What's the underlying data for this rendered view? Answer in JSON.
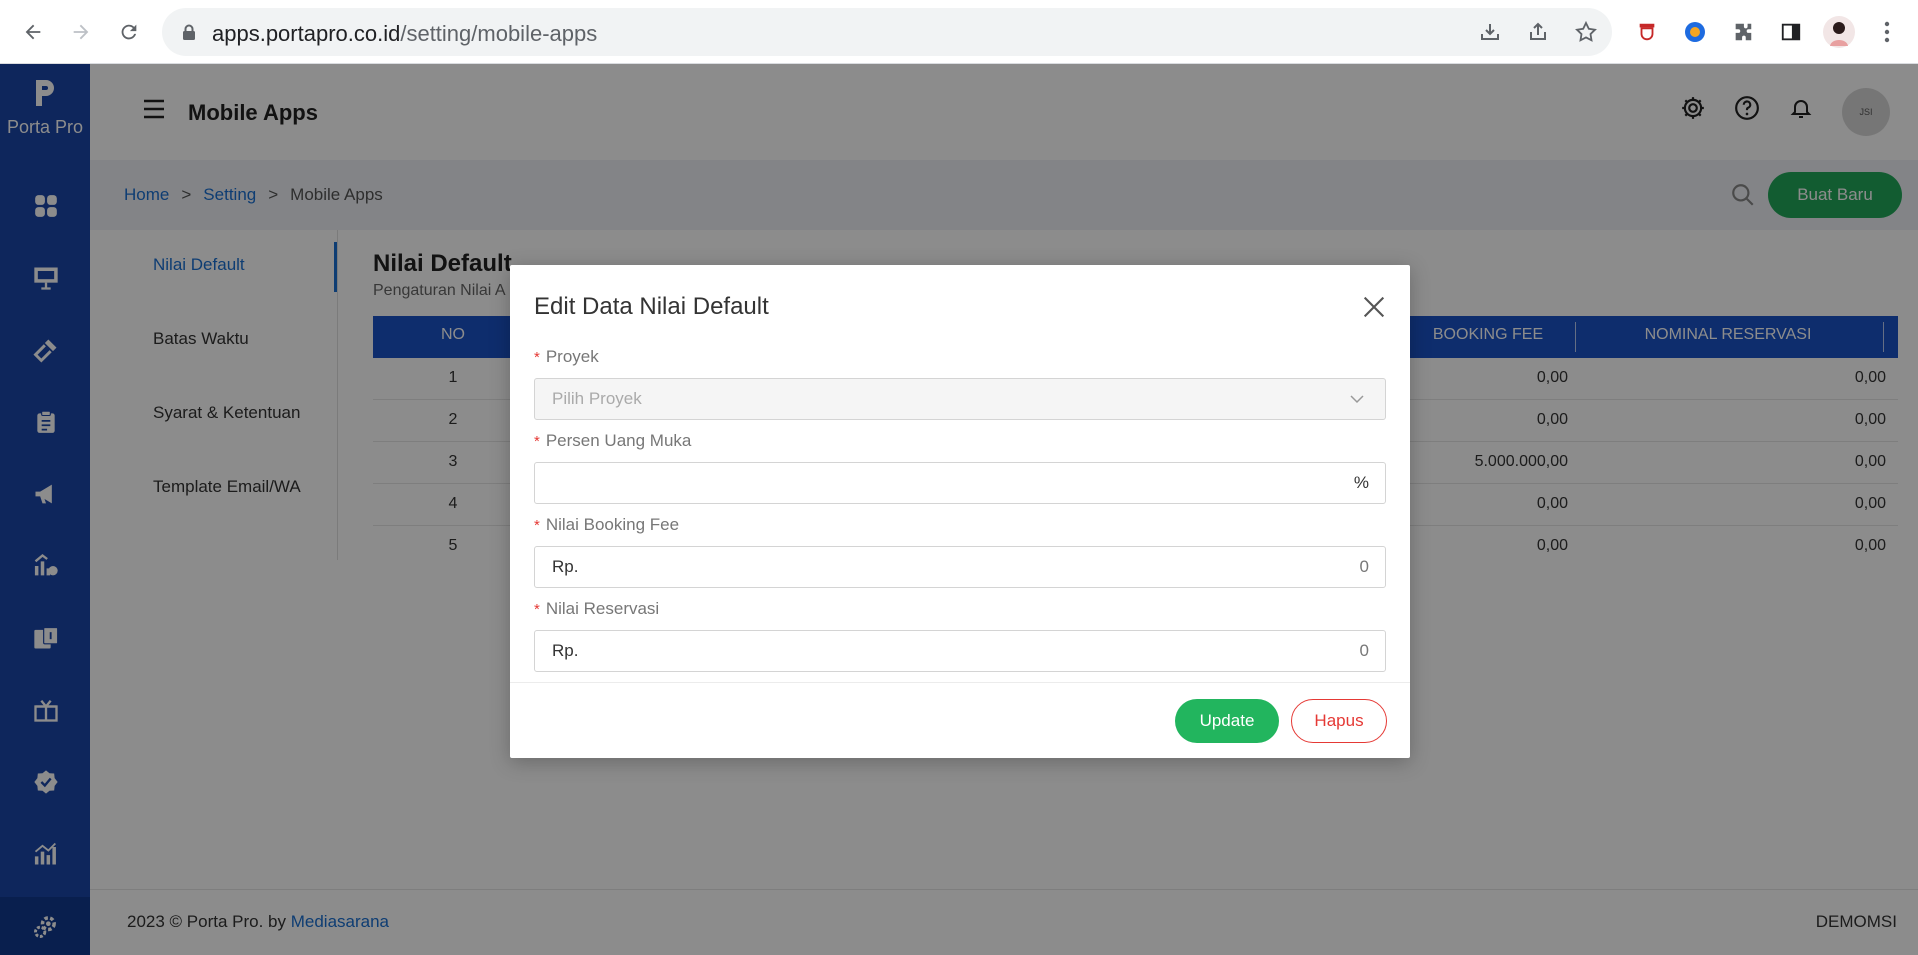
{
  "browser": {
    "url_host": "apps.portapro.co.id",
    "url_path": "/setting/mobile-apps"
  },
  "app": {
    "logo_text": "Porta Pro",
    "page_title": "Mobile Apps",
    "breadcrumb": [
      "Home",
      "Setting",
      "Mobile Apps"
    ],
    "create_button": "Buat Baru",
    "avatar_text": "JSI"
  },
  "tabs": [
    "Nilai Default",
    "Batas Waktu",
    "Syarat & Ketentuan",
    "Template Email/WA"
  ],
  "section": {
    "title": "Nilai Default",
    "subtitle": "Pengaturan Nilai A"
  },
  "table": {
    "headers": [
      "NO",
      "BOOKING FEE",
      "NOMINAL RESERVASI"
    ],
    "rows": [
      {
        "no": "1",
        "booking_fee": "0,00",
        "reservasi": "0,00"
      },
      {
        "no": "2",
        "booking_fee": "0,00",
        "reservasi": "0,00"
      },
      {
        "no": "3",
        "booking_fee": "5.000.000,00",
        "reservasi": "0,00"
      },
      {
        "no": "4",
        "booking_fee": "0,00",
        "reservasi": "0,00"
      },
      {
        "no": "5",
        "booking_fee": "0,00",
        "reservasi": "0,00"
      }
    ]
  },
  "footer": {
    "copyright": "2023 © Porta Pro. by ",
    "company": "Mediasarana",
    "user": "DEMOMSI"
  },
  "modal": {
    "title": "Edit Data Nilai Default",
    "required_mark": "*",
    "fields": {
      "proyek_label": "Proyek",
      "proyek_placeholder": "Pilih Proyek",
      "persen_label": "Persen Uang Muka",
      "persen_suffix": "%",
      "booking_label": "Nilai Booking Fee",
      "booking_prefix": "Rp.",
      "booking_value": "0",
      "reservasi_label": "Nilai Reservasi",
      "reservasi_prefix": "Rp.",
      "reservasi_value": "0"
    },
    "update_button": "Update",
    "delete_button": "Hapus"
  },
  "colors": {
    "brand": "#1a45a8",
    "success": "#22b55e",
    "danger": "#e53935",
    "link": "#1a6fd1"
  }
}
